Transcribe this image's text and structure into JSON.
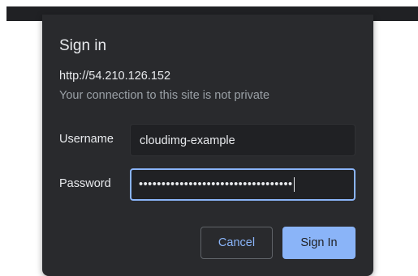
{
  "dialog": {
    "title": "Sign in",
    "origin": "http://54.210.126.152",
    "warning": "Your connection to this site is not private"
  },
  "form": {
    "username_label": "Username",
    "username_value": "cloudimg-example",
    "password_label": "Password",
    "password_value": "••••••••••••••••••••••••••••••••••"
  },
  "buttons": {
    "cancel_label": "Cancel",
    "signin_label": "Sign In"
  },
  "colors": {
    "dialog_bg": "#292a2d",
    "field_bg": "#202124",
    "accent": "#8ab4f8",
    "text": "#e8eaed",
    "muted_text": "#9aa0a6"
  }
}
